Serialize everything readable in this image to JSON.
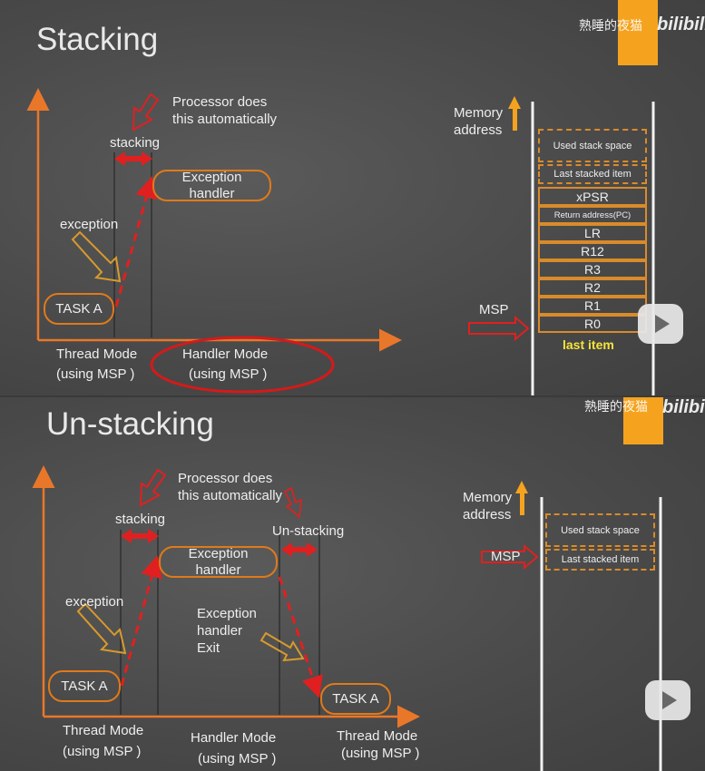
{
  "top": {
    "title": "Stacking",
    "processor_note_line1": "Processor does",
    "processor_note_line2": "this automatically",
    "stacking_label": "stacking",
    "exception_label": "exception",
    "exception_handler_line1": "Exception",
    "exception_handler_line2": "handler",
    "task_a": "TASK A",
    "thread_mode": "Thread Mode",
    "thread_mode_sub": "(using MSP )",
    "handler_mode": "Handler Mode",
    "handler_mode_sub": "(using MSP )",
    "memory_label_line1": "Memory",
    "memory_label_line2": "address",
    "msp_label": "MSP",
    "last_item_label": "last item",
    "stack_items": [
      "Used stack space",
      "Last stacked item",
      "xPSR",
      "Return address(PC)",
      "LR",
      "R12",
      "R3",
      "R2",
      "R1",
      "R0"
    ],
    "watermark": "熟睡的夜猫",
    "logo": "bilibili"
  },
  "bottom": {
    "title": "Un-stacking",
    "processor_note_line1": "Processor does",
    "processor_note_line2": "this automatically",
    "stacking_label": "stacking",
    "unstacking_label": "Un-stacking",
    "exception_label": "exception",
    "exception_handler_line1": "Exception",
    "exception_handler_line2": "handler",
    "exception_exit_line1": "Exception",
    "exception_exit_line2": "handler",
    "exception_exit_line3": "Exit",
    "task_a_left": "TASK A",
    "task_a_right": "TASK A",
    "thread_mode_left": "Thread Mode",
    "thread_mode_left_sub": "(using MSP )",
    "handler_mode": "Handler Mode",
    "handler_mode_sub": "(using MSP )",
    "thread_mode_right": "Thread Mode",
    "thread_mode_right_sub": "(using MSP )",
    "memory_label_line1": "Memory",
    "memory_label_line2": "address",
    "msp_label": "MSP",
    "stack_items": [
      "Used stack space",
      "Last stacked item"
    ],
    "watermark": "熟睡的夜猫",
    "logo": "bilibili"
  },
  "colors": {
    "axis": "#e9772a",
    "red": "#e02020",
    "pill_border": "#e07a1a",
    "stack_border": "#d98b2a",
    "orange_block": "#f5a31f",
    "last_item": "#f5e43a"
  },
  "icons": [
    "play-icon",
    "bilibili-logo"
  ]
}
